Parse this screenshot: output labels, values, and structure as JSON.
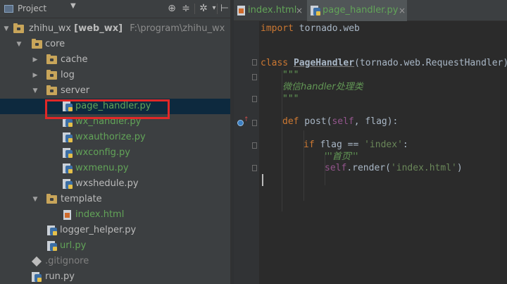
{
  "project_panel": {
    "title": "Project",
    "tree": [
      {
        "label": "zhihu_wx",
        "badge": "[web_wx]",
        "path": "F:\\program\\zhihu_wx",
        "type": "root"
      },
      {
        "label": "core",
        "type": "folder"
      },
      {
        "label": "cache",
        "type": "folder"
      },
      {
        "label": "log",
        "type": "folder"
      },
      {
        "label": "server",
        "type": "folder"
      },
      {
        "label": "page_handler.py",
        "type": "py",
        "selected": true
      },
      {
        "label": "wx_handler.py",
        "type": "py"
      },
      {
        "label": "wxauthorize.py",
        "type": "py"
      },
      {
        "label": "wxconfig.py",
        "type": "py"
      },
      {
        "label": "wxmenu.py",
        "type": "py"
      },
      {
        "label": "wxshedule.py",
        "type": "py"
      },
      {
        "label": "template",
        "type": "folder"
      },
      {
        "label": "index.html",
        "type": "html"
      },
      {
        "label": "logger_helper.py",
        "type": "py"
      },
      {
        "label": "url.py",
        "type": "py"
      },
      {
        "label": ".gitignore",
        "type": "git"
      },
      {
        "label": "run.py",
        "type": "py"
      }
    ]
  },
  "editor": {
    "tabs": [
      {
        "label": "index.html",
        "close": "×"
      },
      {
        "label": "page_handler.py",
        "close": "×",
        "active": true
      }
    ],
    "code": {
      "l1_kw": "import",
      "l1_rest": " tornado.web",
      "l2_kw": "class",
      "l2_name": "PageHandler",
      "l2_rest": "(tornado.web.RequestHandler):",
      "l3": "\"\"\"",
      "l4": "微信handler处理类",
      "l5": "\"\"\"",
      "l6_kw": "def",
      "l6_rest1": " post(",
      "l6_self": "self",
      "l6_rest2": ", flag):",
      "l7_kw": "if",
      "l7_rest": " flag == ",
      "l7_str": "'index'",
      "l7_colon": ":",
      "l8": "'''首页'''",
      "l9_self": "self",
      "l9_rest": ".render(",
      "l9_str": "'index.html'",
      "l9_close": ")"
    }
  },
  "colors": {
    "selection": "#0d293e",
    "highlight_box": "#e02828",
    "green_file": "#62a458",
    "keyword": "#cc7832",
    "string": "#6a8759"
  }
}
